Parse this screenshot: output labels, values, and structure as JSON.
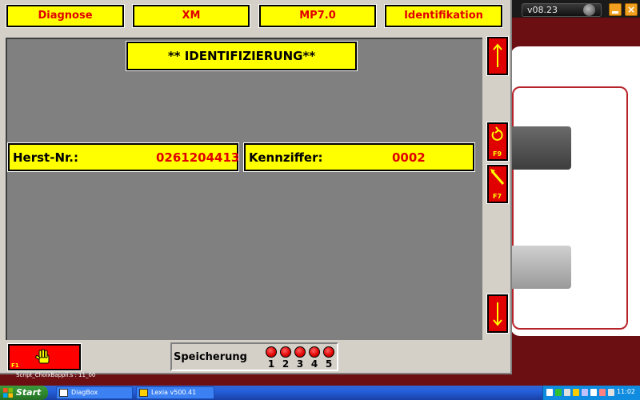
{
  "background_app": {
    "version": "v08.23",
    "close_glyph": "×"
  },
  "window": {
    "tabs": [
      {
        "label": "Diagnose"
      },
      {
        "label": "XM"
      },
      {
        "label": "MP7.0"
      },
      {
        "label": "Identifikation"
      }
    ],
    "title": "** IDENTIFIZIERUNG**",
    "fields": [
      {
        "label": "Herst-Nr.:",
        "value": "0261204413"
      },
      {
        "label": "Kennziffer:",
        "value": "0002"
      }
    ],
    "side_buttons": {
      "back_fkey": "F9",
      "edit_fkey": "F7"
    },
    "hand_fkey": "F1",
    "storage": {
      "label": "Speicherung",
      "slots": [
        "1",
        "2",
        "3",
        "4",
        "5"
      ]
    },
    "status_line": "Script_ChoixBappli.s : 11_00"
  },
  "taskbar": {
    "start_label": "Start",
    "items": [
      {
        "label": "DiagBox"
      },
      {
        "label": "Lexia v500.41"
      }
    ],
    "clock": "11:02"
  },
  "colors": {
    "accent_yellow": "#ffff00",
    "accent_red": "#e00000",
    "content_grey": "#808080",
    "bg_app": "#6b0f12"
  }
}
